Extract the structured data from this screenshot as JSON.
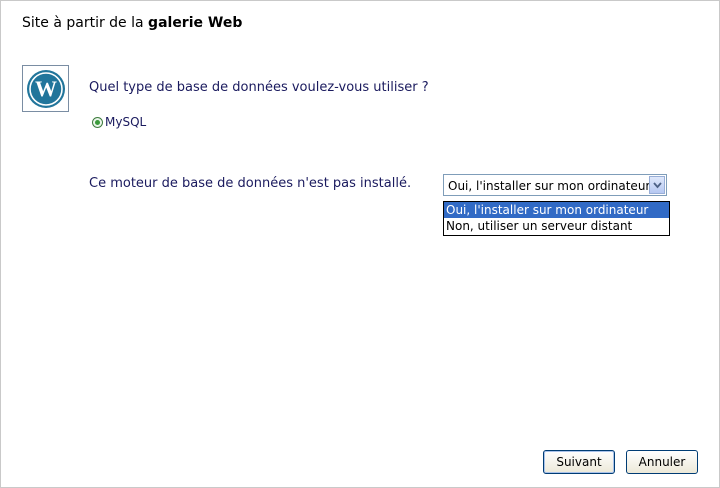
{
  "window": {
    "title_prefix": "Site à partir de la ",
    "title_bold": "galerie Web"
  },
  "content": {
    "logo_icon": "wordpress-logo-icon",
    "question": "Quel type de base de données voulez-vous utiliser ?",
    "radio_option": "MySQL",
    "engine_message": "Ce moteur de base de données n'est pas installé.",
    "select": {
      "value": "Oui, l'installer sur mon ordinateur",
      "options": [
        "Oui, l'installer sur mon ordinateur",
        "Non, utiliser un serveur distant"
      ]
    }
  },
  "buttons": {
    "next": "Suivant",
    "cancel": "Annuler"
  },
  "colors": {
    "selection": "#316ac5",
    "text_blue": "#1a1a5e"
  }
}
